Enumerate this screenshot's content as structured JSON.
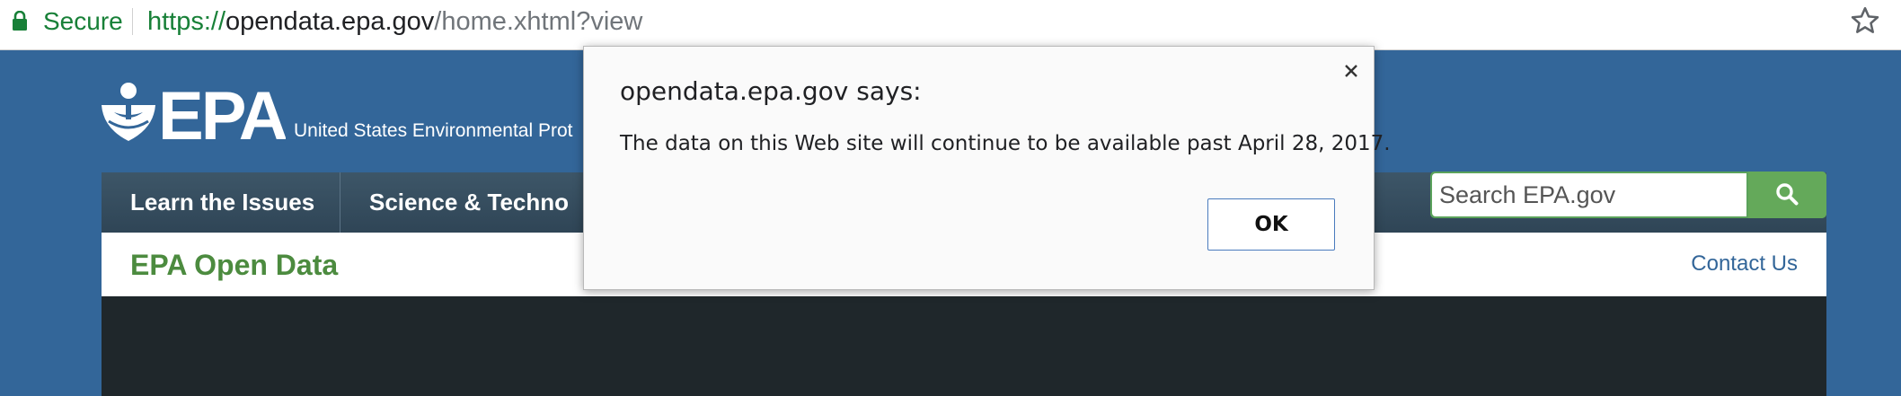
{
  "browser": {
    "secure_label": "Secure",
    "url_scheme": "https://",
    "url_host": "opendata.epa.gov",
    "url_path": "/home.xhtml?view",
    "icons": {
      "lock": "lock-icon",
      "bookmark": "star-icon"
    },
    "secure_color": "#188038"
  },
  "header": {
    "logo_text": "EPA",
    "agency_name": "United States Environmental Prot",
    "brand_color": "#336699"
  },
  "nav": {
    "items": [
      {
        "label": "Learn the Issues"
      },
      {
        "label": "Science & Techno"
      }
    ]
  },
  "search": {
    "placeholder": "Search EPA.gov",
    "icon": "search-icon",
    "button_color": "#64a95a"
  },
  "subheader": {
    "title": "EPA Open Data",
    "contact_label": "Contact Us",
    "title_color": "#4c8b3f"
  },
  "dialog": {
    "title": "opendata.epa.gov says:",
    "message": "The data on this Web site will continue to be available past April 28, 2017.",
    "ok_label": "OK",
    "close_icon": "close-icon"
  }
}
